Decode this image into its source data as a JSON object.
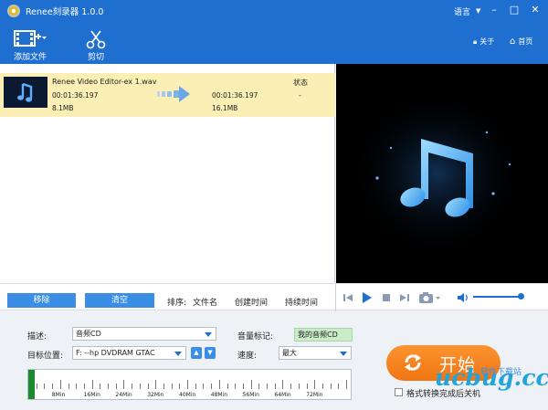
{
  "app": {
    "title": "Renee刻录器 1.0.0"
  },
  "titlebar": {
    "language_label": "语言"
  },
  "toolbar": {
    "add_file_label": "添加文件",
    "cut_label": "剪切",
    "about_label": "关于",
    "home_label": "首页"
  },
  "file_list": {
    "items": [
      {
        "name": "Renee Video Editor-ex 1.wav",
        "source_duration": "00:01:36.197",
        "source_size": "8.1MB",
        "output_duration": "00:01:36.197",
        "output_size": "16.1MB",
        "status_header": "状态",
        "status_value": "-"
      }
    ]
  },
  "actions": {
    "remove_label": "移除",
    "clear_label": "清空",
    "sort_label": "排序:",
    "sort_filename": "文件名",
    "sort_created": "创建时间",
    "sort_duration": "持续时间"
  },
  "player": {
    "volume_fraction": 0.95
  },
  "settings": {
    "description_label": "描述:",
    "description_value": "音频CD",
    "volume_label_label": "音量标记:",
    "volume_label_value": "我的音频CD",
    "target_label": "目标位置:",
    "target_value": "F:  --hp      DVDRAM GTAC",
    "speed_label": "速度:",
    "speed_value": "最大",
    "capacity_ticks": [
      "8Min",
      "16Min",
      "24Min",
      "32Min",
      "40Min",
      "48Min",
      "56Min",
      "64Min",
      "72Min"
    ],
    "capacity_used_minutes": 1.6
  },
  "start": {
    "label": "开始",
    "shutdown_label": "格式转换完成后关机"
  },
  "watermark": {
    "text": "ucbug.cc",
    "subtext": "软件下载站"
  },
  "colors": {
    "brand_blue": "#1e6fd0",
    "start_orange": "#f58220",
    "selected_row": "#fbefb5",
    "progress_green": "#1a8a2a"
  }
}
